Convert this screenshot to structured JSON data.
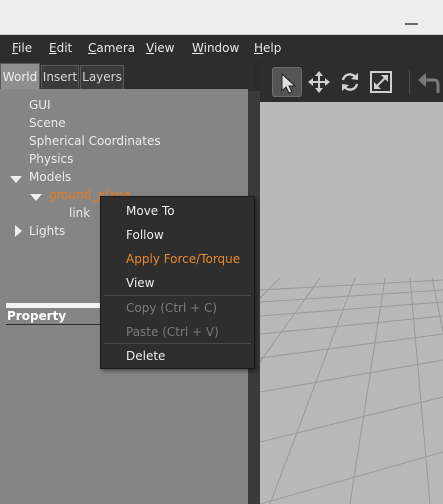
{
  "menubar": {
    "items": [
      {
        "label": "File",
        "mnemonic": "F",
        "rest": "ile"
      },
      {
        "label": "Edit",
        "mnemonic": "E",
        "rest": "dit"
      },
      {
        "label": "Camera",
        "mnemonic": "C",
        "rest": "amera"
      },
      {
        "label": "View",
        "mnemonic": "V",
        "rest": "iew"
      },
      {
        "label": "Window",
        "mnemonic": "W",
        "rest": "indow"
      },
      {
        "label": "Help",
        "mnemonic": "H",
        "rest": "elp"
      }
    ]
  },
  "left_panel": {
    "tabs": [
      {
        "label": "World",
        "active": true
      },
      {
        "label": "Insert",
        "active": false
      },
      {
        "label": "Layers",
        "active": false
      }
    ],
    "tree": {
      "gui": "GUI",
      "scene": "Scene",
      "spherical": "Spherical Coordinates",
      "physics": "Physics",
      "models": "Models",
      "ground_plane": "ground_plane",
      "link": "link",
      "lights": "Lights"
    },
    "property_header": "Property"
  },
  "toolbar": {
    "tools": [
      "select-mode-icon",
      "translate-mode-icon",
      "rotate-mode-icon",
      "scale-mode-icon",
      "undo-icon"
    ],
    "active_tool": "select-mode-icon"
  },
  "context_menu": {
    "items": [
      {
        "label": "Move To",
        "state": "normal"
      },
      {
        "label": "Follow",
        "state": "normal"
      },
      {
        "label": "Apply Force/Torque",
        "state": "highlight"
      },
      {
        "label": "View",
        "state": "normal"
      },
      {
        "label": "Copy (Ctrl + C)",
        "state": "disabled"
      },
      {
        "label": "Paste (Ctrl + V)",
        "state": "disabled"
      },
      {
        "label": "Delete",
        "state": "normal"
      }
    ]
  },
  "colors": {
    "accent": "#e87c1e",
    "panel": "#858585",
    "menu_bg": "#2d2d2d",
    "viewport": "#b9b9b9"
  }
}
